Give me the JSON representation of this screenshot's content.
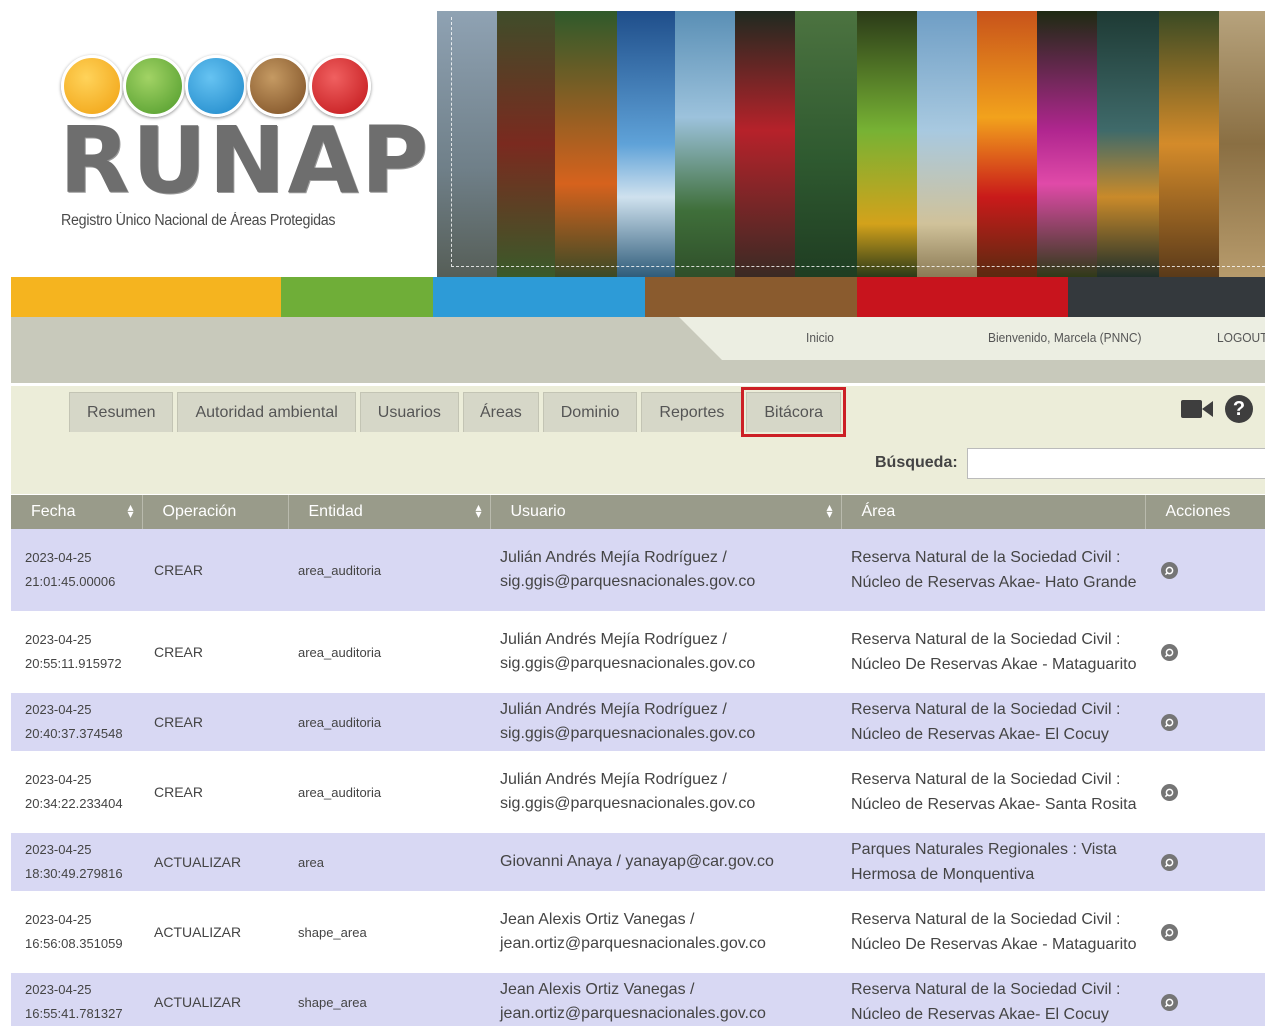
{
  "colors": {
    "yellow": "#f5b41f",
    "green": "#6fae38",
    "blue": "#2d9bd7",
    "brown": "#8a5b2e",
    "red": "#c8141d",
    "dark": "#34393d",
    "row_highlight": "#d8d8f3",
    "table_header": "#999b8a",
    "tab_highlight_border": "#cc1f25"
  },
  "header": {
    "logo_word": "RUNAP",
    "logo_subtitle": "Registro Único Nacional de Áreas Protegidas",
    "logo_circle_icons": [
      "palm-tree-icon",
      "leaf-icon",
      "mountain-icon",
      "grass-icon",
      "bear-icon"
    ]
  },
  "nav": {
    "home": "Inicio",
    "welcome": "Bienvenido, Marcela (PNNC)",
    "logout": "LOGOUT"
  },
  "tabs": [
    {
      "label": "Resumen"
    },
    {
      "label": "Autoridad ambiental"
    },
    {
      "label": "Usuarios"
    },
    {
      "label": "Áreas"
    },
    {
      "label": "Dominio"
    },
    {
      "label": "Reportes"
    },
    {
      "label": "Bitácora",
      "highlighted": true
    }
  ],
  "toolbar": {
    "video_icon": "video-camera-icon",
    "help_icon": "help-icon",
    "help_glyph": "?"
  },
  "search": {
    "label": "Búsqueda:",
    "value": ""
  },
  "table": {
    "columns": [
      "Fecha",
      "Operación",
      "Entidad",
      "Usuario",
      "Área",
      "Acciones"
    ],
    "rows": [
      {
        "fecha": "2023-04-25 21:01:45.00006",
        "operacion": "CREAR",
        "entidad": "area_auditoria",
        "usuario": "Julián Andrés Mejía Rodríguez / sig.ggis@parquesnacionales.gov.co",
        "area": "Reserva Natural de la Sociedad Civil : Núcleo de Reservas Akae- Hato Grande"
      },
      {
        "fecha": "2023-04-25 20:55:11.915972",
        "operacion": "CREAR",
        "entidad": "area_auditoria",
        "usuario": "Julián Andrés Mejía Rodríguez / sig.ggis@parquesnacionales.gov.co",
        "area": "Reserva Natural de la Sociedad Civil : Núcleo De Reservas Akae - Mataguarito"
      },
      {
        "fecha": "2023-04-25 20:40:37.374548",
        "operacion": "CREAR",
        "entidad": "area_auditoria",
        "usuario": "Julián Andrés Mejía Rodríguez / sig.ggis@parquesnacionales.gov.co",
        "area": "Reserva Natural de la Sociedad Civil : Núcleo de Reservas Akae- El Cocuy"
      },
      {
        "fecha": "2023-04-25 20:34:22.233404",
        "operacion": "CREAR",
        "entidad": "area_auditoria",
        "usuario": "Julián Andrés Mejía Rodríguez / sig.ggis@parquesnacionales.gov.co",
        "area": "Reserva Natural de la Sociedad Civil : Núcleo de Reservas Akae- Santa Rosita"
      },
      {
        "fecha": "2023-04-25 18:30:49.279816",
        "operacion": "ACTUALIZAR",
        "entidad": "area",
        "usuario": "Giovanni Anaya / yanayap@car.gov.co",
        "area": "Parques Naturales Regionales : Vista Hermosa de Monquentiva"
      },
      {
        "fecha": "2023-04-25 16:56:08.351059",
        "operacion": "ACTUALIZAR",
        "entidad": "shape_area",
        "usuario": "Jean Alexis Ortiz Vanegas / jean.ortiz@parquesnacionales.gov.co",
        "area": "Reserva Natural de la Sociedad Civil : Núcleo De Reservas Akae - Mataguarito"
      },
      {
        "fecha": "2023-04-25 16:55:41.781327",
        "operacion": "ACTUALIZAR",
        "entidad": "shape_area",
        "usuario": "Jean Alexis Ortiz Vanegas / jean.ortiz@parquesnacionales.gov.co",
        "area": "Reserva Natural de la Sociedad Civil : Núcleo de Reservas Akae- El Cocuy"
      }
    ],
    "action_icon": "view-icon"
  }
}
